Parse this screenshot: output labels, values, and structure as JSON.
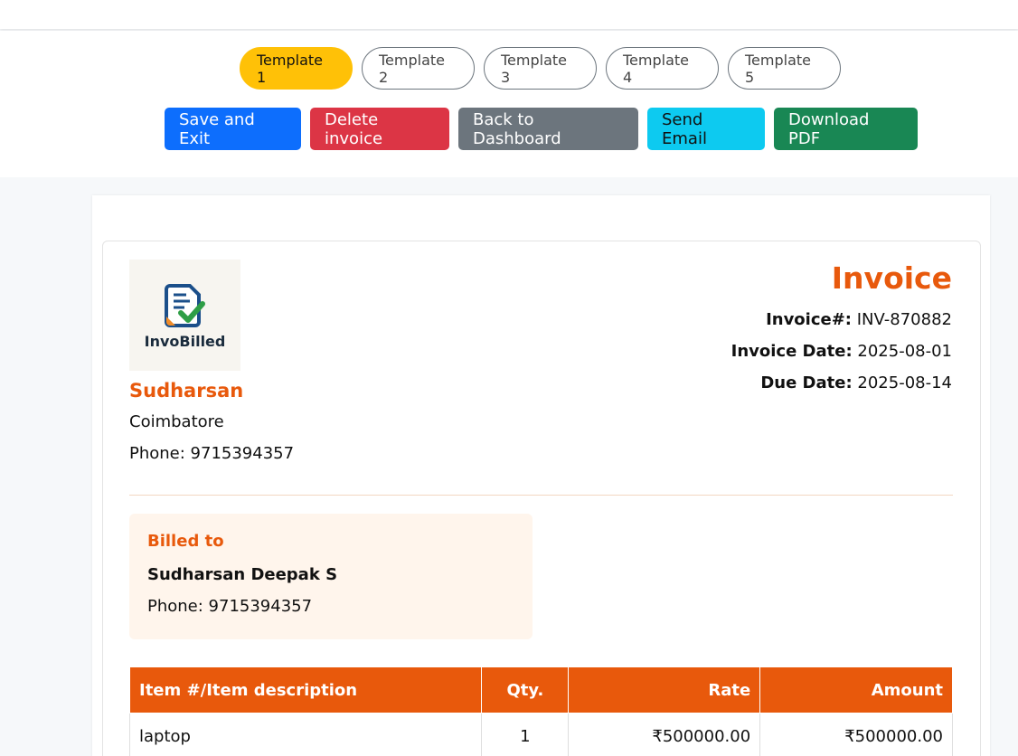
{
  "templates": [
    {
      "label": "Template 1"
    },
    {
      "label": "Template 2"
    },
    {
      "label": "Template 3"
    },
    {
      "label": "Template 4"
    },
    {
      "label": "Template 5"
    }
  ],
  "actions": {
    "save": "Save and Exit",
    "delete": "Delete invoice",
    "dashboard": "Back to Dashboard",
    "email": "Send Email",
    "pdf": "Download PDF"
  },
  "logo": {
    "text": "InvoBilled"
  },
  "seller": {
    "name": "Sudharsan",
    "city": "Coimbatore",
    "phone": "Phone: 9715394357"
  },
  "invoice": {
    "title": "Invoice",
    "number_label": "Invoice#:",
    "number": "INV-870882",
    "date_label": "Invoice Date:",
    "date": "2025-08-01",
    "due_label": "Due Date:",
    "due": "2025-08-14"
  },
  "billed_to": {
    "heading": "Billed to",
    "name": "Sudharsan Deepak S",
    "phone": "Phone: 9715394357"
  },
  "table": {
    "headers": [
      "Item #/Item description",
      "Qty.",
      "Rate",
      "Amount"
    ],
    "rows": [
      [
        "laptop",
        "1",
        "₹500000.00",
        "₹500000.00"
      ]
    ]
  }
}
